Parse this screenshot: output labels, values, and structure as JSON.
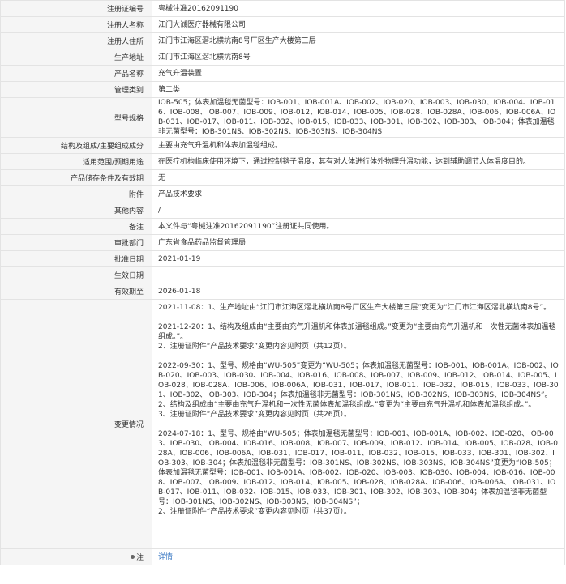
{
  "rows": [
    {
      "label": "注册证编号",
      "value": "粤械注准20162091190"
    },
    {
      "label": "注册人名称",
      "value": "江门大诚医疗器械有限公司"
    },
    {
      "label": "注册人住所",
      "value": "江门市江海区滘北横坑南8号厂区生产大楼第三层"
    },
    {
      "label": "生产地址",
      "value": "江门市江海区滘北横坑南8号"
    },
    {
      "label": "产品名称",
      "value": "充气升温装置"
    },
    {
      "label": "管理类别",
      "value": "第二类"
    },
    {
      "label": "型号规格",
      "value": "IOB-505；体表加温毯无菌型号：IOB-001、IOB-001A、IOB-002、IOB-020、IOB-003、IOB-030、IOB-004、IOB-016、IOB-008、IOB-007、IOB-009、IOB-012、IOB-014、IOB-005、IOB-028、IOB-028A、IOB-006、IOB-006A、IOB-031、IOB-017、IOB-011、IOB-032、IOB-015、IOB-033、IOB-301、IOB-302、IOB-303、IOB-304；体表加温毯非无菌型号：IOB-301NS、IOB-302NS、IOB-303NS、IOB-304NS"
    },
    {
      "label": "结构及组成/主要组成成分",
      "value": "主要由充气升温机和体表加温毯组成。"
    },
    {
      "label": "适用范围/预期用途",
      "value": "在医疗机构临床使用环境下，通过控制毯子温度，其有对人体进行体外物理升温功能，达到辅助调节人体温度目的。"
    },
    {
      "label": "产品储存条件及有效期",
      "value": "无"
    },
    {
      "label": "附件",
      "value": "产品技术要求"
    },
    {
      "label": "其他内容",
      "value": "/"
    },
    {
      "label": "备注",
      "value": "本义件与“粤械注准20162091190”注册证共同使用。"
    },
    {
      "label": "审批部门",
      "value": "广东省食品药品监督管理局"
    },
    {
      "label": "批准日期",
      "value": "2021-01-19"
    },
    {
      "label": "生效日期",
      "value": ""
    },
    {
      "label": "有效期至",
      "value": "2026-01-18"
    }
  ],
  "changes": {
    "label": "变更情况",
    "entries": [
      [
        "2021-11-08：1、生产地址由“江门市江海区滘北横坑南8号厂区生产大楼第三层”变更为“江门市江海区滘北横坑南8号”。"
      ],
      [
        "2021-12-20：1、结构及组成由“主要由充气升温机和体表加温毯组成。”变更为“主要由充气升温机和一次性无菌体表加温毯组成。”。",
        "2、注册证附件“产品技术要求”变更内容见附页（共12页）。"
      ],
      [
        "2022-09-30：1、型号、规格由“WU-505”变更为“WU-505；体表加温毯无菌型号：IOB-001、IOB-001A、IOB-002、IOB-020、IOB-003、IOB-030、IOB-004、IOB-016、IOB-008、IOB-007、IOB-009、IOB-012、IOB-014、IOB-005、IOB-028、IOB-028A、IOB-006、IOB-006A、IOB-031、IOB-017、IOB-011、IOB-032、IOB-015、IOB-033、IOB-301、IOB-302、IOB-303、IOB-304；体表加温毯非无菌型号：IOB-301NS、IOB-302NS、IOB-303NS、IOB-304NS”。",
        "2、结构及组成由“主要由充气升温机和一次性无菌体表加温毯组成。”变更为“主要由充气升温机和体表加温毯组成。”。",
        "3、注册证附件“产品技术要求”变更内容见附页（共26页）。"
      ],
      [
        "2024-07-18：1、型号、规格由“WU-505；体表加温毯无菌型号：IOB-001、IOB-001A、IOB-002、IOB-020、IOB-003、IOB-030、IOB-004、IOB-016、IOB-008、IOB-007、IOB-009、IOB-012、IOB-014、IOB-005、IOB-028、IOB-028A、IOB-006、IOB-006A、IOB-031、IOB-017、IOB-011、IOB-032、IOB-015、IOB-033、IOB-301、IOB-302、IOB-303、IOB-304；体表加温毯非无菌型号：IOB-301NS、IOB-302NS、IOB-303NS、IOB-304NS”变更为“IOB-505；体表加温毯无菌型号：IOB-001、IOB-001A、IOB-002、IOB-020、IOB-003、IOB-030、IOB-004、IOB-016、IOB-008、IOB-007、IOB-009、IOB-012、IOB-014、IOB-005、IOB-028、IOB-028A、IOB-006、IOB-006A、IOB-031、IOB-017、IOB-011、IOB-032、IOB-015、IOB-033、IOB-301、IOB-302、IOB-303、IOB-304；体表加温毯非无菌型号：IOB-301NS、IOB-302NS、IOB-303NS、IOB-304NS”；",
        "2、注册证附件“产品技术要求”变更内容见附页（共37页）。"
      ]
    ]
  },
  "note": {
    "label": "注",
    "link": "详情",
    "icon": "pin-icon"
  }
}
